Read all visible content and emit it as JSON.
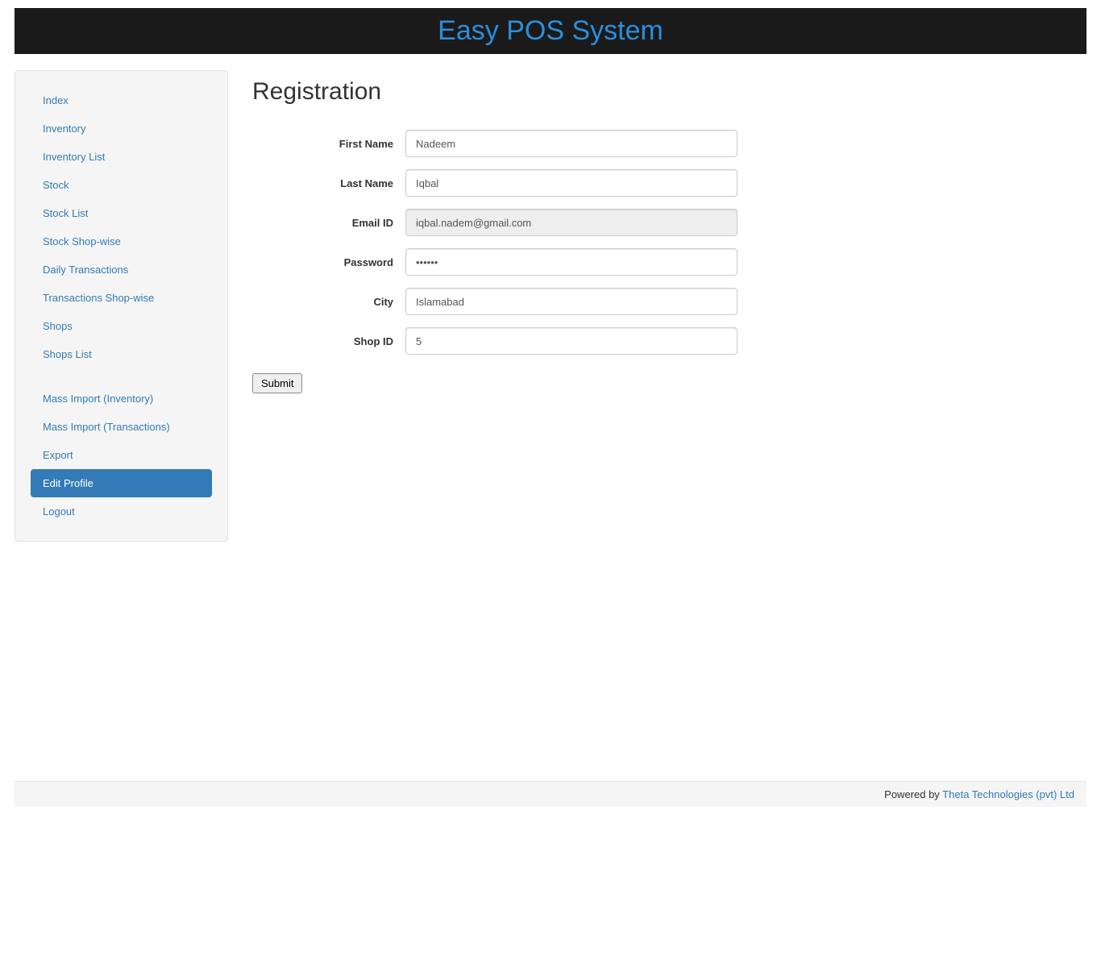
{
  "header": {
    "title": "Easy POS System"
  },
  "sidebar": {
    "group1": [
      {
        "label": "Index"
      },
      {
        "label": "Inventory"
      },
      {
        "label": "Inventory List"
      },
      {
        "label": "Stock"
      },
      {
        "label": "Stock List"
      },
      {
        "label": "Stock Shop-wise"
      },
      {
        "label": "Daily Transactions"
      },
      {
        "label": "Transactions Shop-wise"
      },
      {
        "label": "Shops"
      },
      {
        "label": "Shops List"
      }
    ],
    "group2": [
      {
        "label": "Mass Import (Inventory)"
      },
      {
        "label": "Mass Import (Transactions)"
      },
      {
        "label": "Export"
      },
      {
        "label": "Edit Profile"
      },
      {
        "label": "Logout"
      }
    ]
  },
  "main": {
    "title": "Registration",
    "labels": {
      "first_name": "First Name",
      "last_name": "Last Name",
      "email_id": "Email ID",
      "password": "Password",
      "city": "City",
      "shop_id": "Shop ID"
    },
    "values": {
      "first_name": "Nadeem",
      "last_name": "Iqbal",
      "email_id": "iqbal.nadem@gmail.com",
      "password": "••••••",
      "city": "Islamabad",
      "shop_id": "5"
    },
    "submit_label": "Submit"
  },
  "footer": {
    "prefix": "Powered by ",
    "link": "Theta Technologies (pvt) Ltd"
  }
}
